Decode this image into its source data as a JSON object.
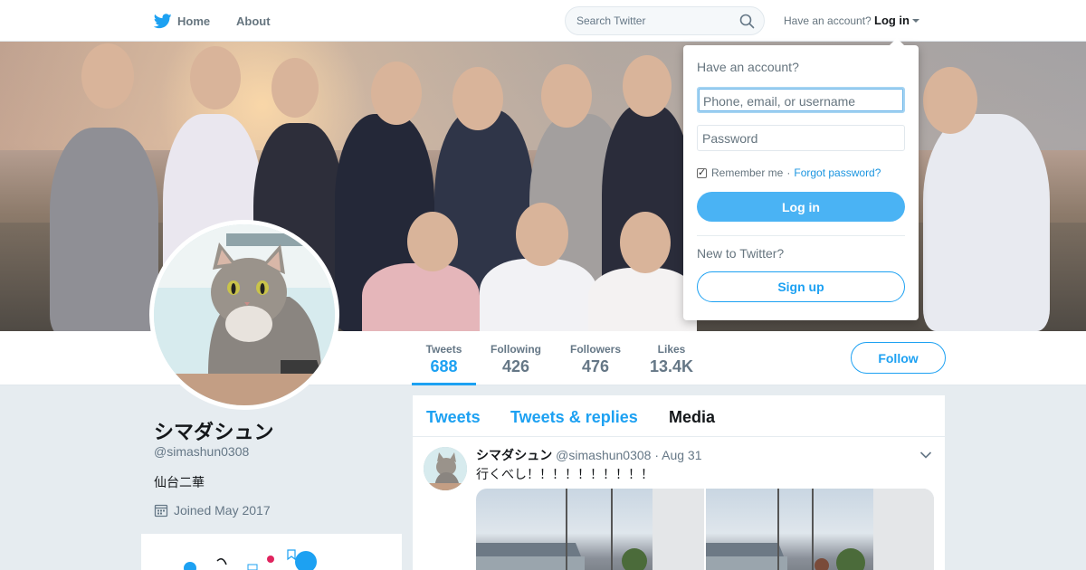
{
  "nav": {
    "home_label": "Home",
    "about_label": "About",
    "search_placeholder": "Search Twitter",
    "account_question": "Have an account?",
    "login_label": "Log in"
  },
  "login_dropdown": {
    "title": "Have an account?",
    "username_placeholder": "Phone, email, or username",
    "password_placeholder": "Password",
    "remember_label": "Remember me",
    "separator": "·",
    "forgot_label": "Forgot password?",
    "login_button": "Log in",
    "new_label": "New to Twitter?",
    "signup_button": "Sign up"
  },
  "stats": [
    {
      "label": "Tweets",
      "value": "688"
    },
    {
      "label": "Following",
      "value": "426"
    },
    {
      "label": "Followers",
      "value": "476"
    },
    {
      "label": "Likes",
      "value": "13.4K"
    }
  ],
  "follow_button": "Follow",
  "profile": {
    "name": "シマダシュン",
    "handle": "@simashun0308",
    "bio": "仙台二華",
    "joined": "Joined May 2017"
  },
  "timeline": {
    "tabs": [
      "Tweets",
      "Tweets & replies",
      "Media"
    ],
    "active_tab": "Media"
  },
  "tweet": {
    "name": "シマダシュン",
    "handle": "@simashun0308",
    "date": "· Aug 31",
    "text": "行くべし！！！！！！！！！！"
  },
  "colors": {
    "accent": "#1da1f2",
    "login_button": "#4ab3f4"
  }
}
